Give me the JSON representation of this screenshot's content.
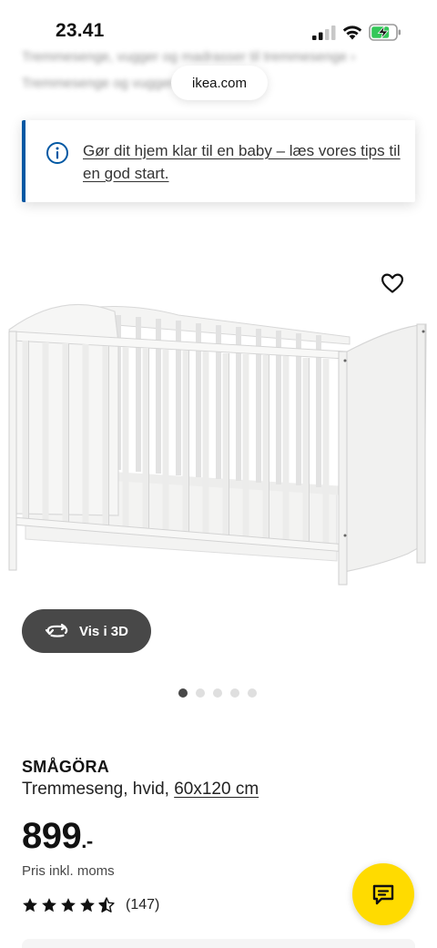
{
  "status_bar": {
    "time": "23.41",
    "icons": [
      "cellular-signal-icon",
      "wifi-icon",
      "battery-charging-icon"
    ]
  },
  "breadcrumbs": {
    "line1": "Tremmesenge, vugger og madrasser til tremmesenge",
    "line1_separator": "›",
    "line2": "Tremmesenge og vugger"
  },
  "browser": {
    "url_label": "ikea.com"
  },
  "notice": {
    "icon": "info-icon",
    "text": "Gør dit hjem klar til en baby – læs vores tips til en god start.",
    "accent_color": "#0058a3"
  },
  "gallery": {
    "favourite_icon": "heart-icon",
    "view_3d_label": "Vis i 3D",
    "view_3d_icon": "rotate-3d-icon",
    "page_count": 5,
    "active_page": 1
  },
  "product": {
    "name": "SMÅGÖRA",
    "description": "Tremmeseng, hvid,",
    "size": "60x120 cm",
    "price": "899",
    "price_suffix": ".-",
    "price_note": "Pris inkl. moms",
    "rating_stars": 4.5,
    "rating_count": "(147)"
  },
  "chat": {
    "icon": "chat-icon",
    "color": "#ffdb00"
  }
}
